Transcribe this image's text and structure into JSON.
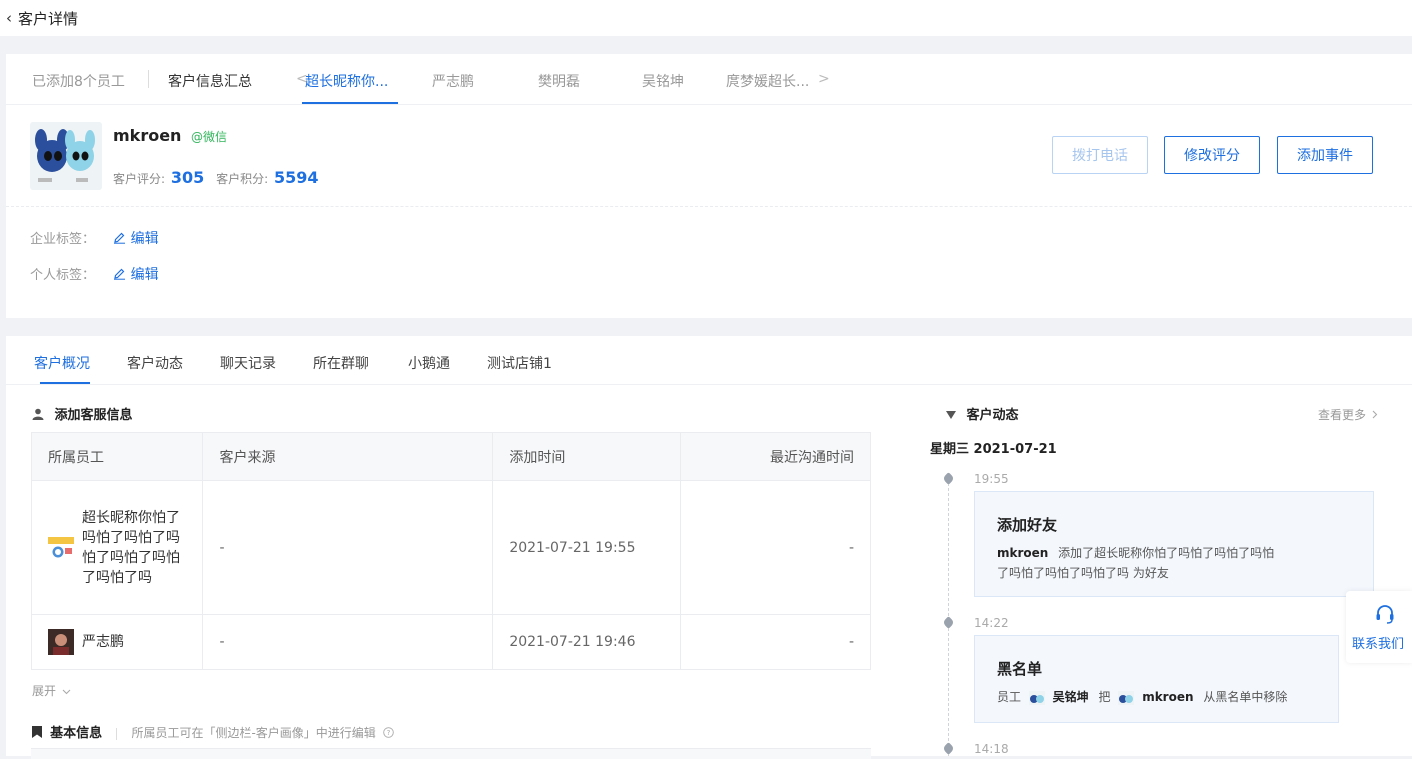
{
  "header": {
    "back_icon": "‹",
    "title": "客户详情"
  },
  "employee_tabs": {
    "added_count": "已添加8个员工",
    "summary": "客户信息汇总",
    "prev_arrow": "<",
    "items": [
      "超长昵称你...",
      "严志鹏",
      "樊明磊",
      "吴铭坤",
      "庹梦媛超长..."
    ],
    "next_arrow": ">"
  },
  "customer": {
    "name": "mkroen",
    "source": "@微信",
    "score_label": "客户评分:",
    "score": "305",
    "points_label": "客户积分:",
    "points": "5594"
  },
  "actions": {
    "call": "拨打电话",
    "edit_score": "修改评分",
    "add_event": "添加事件"
  },
  "tags": {
    "enterprise_label": "企业标签：",
    "personal_label": "个人标签：",
    "edit": "编辑"
  },
  "detail_tabs": [
    "客户概况",
    "客户动态",
    "聊天记录",
    "所在群聊",
    "小鹅通",
    "测试店铺1"
  ],
  "service_info": {
    "title": "添加客服信息",
    "columns": [
      "所属员工",
      "客户来源",
      "添加时间",
      "最近沟通时间"
    ],
    "rows": [
      {
        "employee": "超长昵称你怕了吗怕了吗怕了吗怕了吗怕了吗怕了吗怕了吗",
        "source": "-",
        "added": "2021-07-21 19:55",
        "last": "-"
      },
      {
        "employee": "严志鹏",
        "source": "-",
        "added": "2021-07-21 19:46",
        "last": "-"
      }
    ],
    "expand": "展开"
  },
  "basic_info": {
    "title": "基本信息",
    "hint": "所属员工可在「侧边栏-客户画像」中进行编辑"
  },
  "activity": {
    "title": "客户动态",
    "more": "查看更多",
    "date": "星期三 2021-07-21",
    "events": [
      {
        "time": "19:55",
        "title": "添加好友",
        "actor": "mkroen",
        "text1": "添加了超长昵称你怕了吗怕了吗怕了吗怕",
        "text2": "了吗怕了吗怕了吗怕了吗  为好友"
      },
      {
        "time": "14:22",
        "title": "黑名单",
        "prefix": "员工",
        "staff": "吴铭坤",
        "verb": "把",
        "target": "mkroen",
        "suffix": "从黑名单中移除"
      },
      {
        "time": "14:18"
      }
    ]
  },
  "contact": {
    "label": "联系我们",
    "icon": "headset-icon"
  },
  "colors": {
    "primary": "#1e6fe0",
    "wechat": "#2fb55a",
    "background": "#f0f2f5"
  }
}
